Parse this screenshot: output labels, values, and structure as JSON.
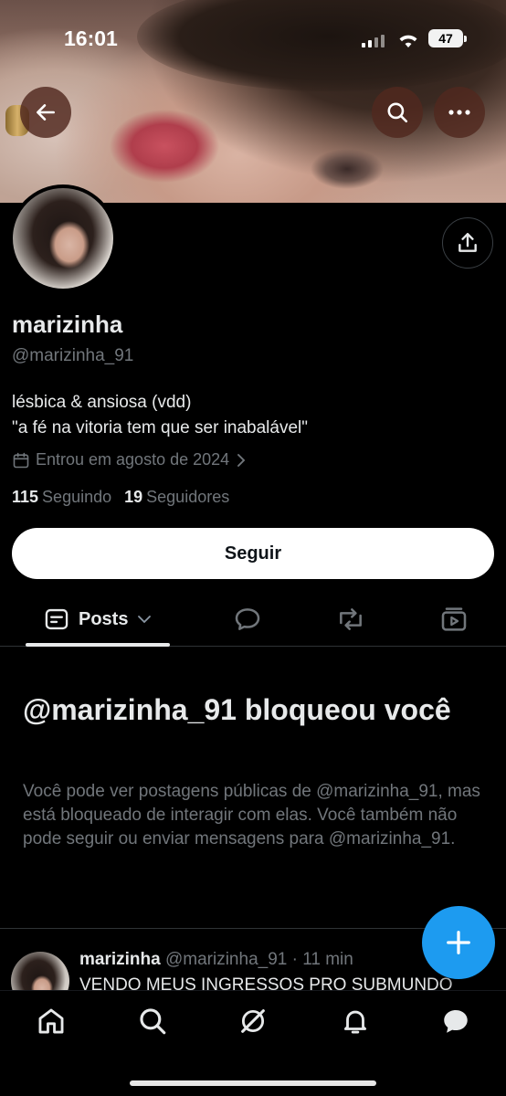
{
  "status_bar": {
    "time": "16:01",
    "battery": "47"
  },
  "profile": {
    "name": "marizinha",
    "handle": "@marizinha_91",
    "bio_line1": "lésbica & ansiosa (vdd)",
    "bio_line2": "\"a fé na vitoria tem que ser inabalável\"",
    "joined": "Entrou em agosto de 2024",
    "following_count": "115",
    "following_label": "Seguindo",
    "followers_count": "19",
    "followers_label": "Seguidores",
    "follow_button": "Seguir"
  },
  "tabs": {
    "posts_label": "Posts"
  },
  "blocked": {
    "title": "@marizinha_91 bloqueou você",
    "text": "Você pode ver postagens públicas de @marizinha_91, mas está bloqueado de interagir com elas. Você também não pode seguir ou enviar mensagens para @marizinha_91."
  },
  "tweet": {
    "name": "marizinha",
    "meta": "@marizinha_91 · 11 min",
    "text": "VENDO MEUS INGRESSOS PRO SUBMUNDO"
  },
  "icons": {
    "back": "arrow-left-icon",
    "search": "search-icon",
    "more": "more-icon",
    "share": "share-icon",
    "calendar": "calendar-icon",
    "replies": "speech-bubble-icon",
    "reposts": "repost-icon",
    "media": "media-icon",
    "compose": "plus-icon",
    "home": "home-icon",
    "explore": "search-icon",
    "grok": "grok-icon",
    "notifications": "bell-icon",
    "messages": "chat-icon"
  },
  "colors": {
    "accent": "#1d9bf0",
    "muted": "#71767b",
    "text": "#e7e9ea",
    "background": "#000000"
  }
}
